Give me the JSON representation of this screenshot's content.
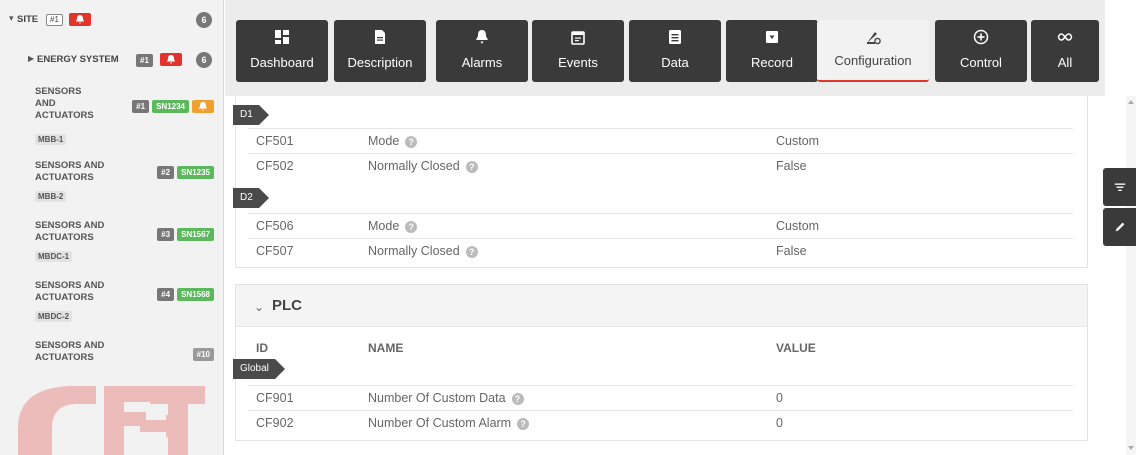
{
  "sidebar": {
    "site": {
      "label": "SITE",
      "tag": "#1",
      "count": "6"
    },
    "energy": {
      "label": "ENERGY SYSTEM",
      "tag": "#1",
      "count": "6"
    },
    "items": [
      {
        "title": "SENSORS AND ACTUATORS",
        "sub": "MBB-1",
        "num": "#1",
        "sn": "SN1234",
        "alarm": true
      },
      {
        "title": "SENSORS AND ACTUATORS",
        "sub": "MBB-2",
        "num": "#2",
        "sn": "SN1235"
      },
      {
        "title": "SENSORS AND ACTUATORS",
        "sub": "MBDC-1",
        "num": "#3",
        "sn": "SN1567"
      },
      {
        "title": "SENSORS AND ACTUATORS",
        "sub": "MBDC-2",
        "num": "#4",
        "sn": "SN1568"
      },
      {
        "title": "SENSORS AND ACTUATORS",
        "num": "#10"
      }
    ],
    "logo_text": "CET"
  },
  "tabs": [
    {
      "label": "Dashboard",
      "icon": "dashboard-icon"
    },
    {
      "label": "Description",
      "icon": "document-icon"
    },
    {
      "label": "Alarms",
      "icon": "bell-icon"
    },
    {
      "label": "Events",
      "icon": "calendar-icon"
    },
    {
      "label": "Data",
      "icon": "data-icon"
    },
    {
      "label": "Record",
      "icon": "record-icon"
    },
    {
      "label": "Configuration",
      "icon": "configuration-icon",
      "active": true
    },
    {
      "label": "Control",
      "icon": "control-icon"
    },
    {
      "label": "All",
      "icon": "infinity-icon"
    }
  ],
  "sections": {
    "top": {
      "groups": [
        {
          "label": "D1",
          "rows": [
            {
              "id": "CF501",
              "name": "Mode",
              "value": "Custom"
            },
            {
              "id": "CF502",
              "name": "Normally Closed",
              "value": "False"
            }
          ]
        },
        {
          "label": "D2",
          "rows": [
            {
              "id": "CF506",
              "name": "Mode",
              "value": "Custom"
            },
            {
              "id": "CF507",
              "name": "Normally Closed",
              "value": "False"
            }
          ]
        }
      ]
    },
    "plc": {
      "title": "PLC",
      "columns": {
        "id": "ID",
        "name": "NAME",
        "value": "VALUE"
      },
      "group_label": "Global",
      "rows": [
        {
          "id": "CF901",
          "name": "Number Of Custom Data",
          "value": "0"
        },
        {
          "id": "CF902",
          "name": "Number Of Custom Alarm",
          "value": "0"
        }
      ]
    }
  },
  "colors": {
    "dark": "#3a3a3a",
    "accent_red": "#e0342d",
    "green": "#5cb85c",
    "orange": "#f0a030"
  }
}
